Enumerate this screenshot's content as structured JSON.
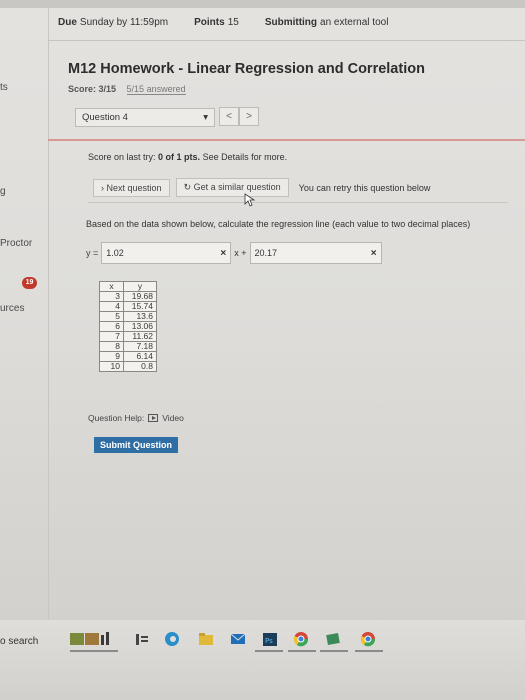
{
  "sidebar": {
    "partial_1": "ts",
    "partial_2": "g",
    "partial_3": "Proctor",
    "badge": "19",
    "partial_4": "urces"
  },
  "header": {
    "due_label": "Due",
    "due_value": "Sunday by 11:59pm",
    "points_label": "Points",
    "points_value": "15",
    "submitting_label": "Submitting",
    "submitting_value": "an external tool"
  },
  "assignment": {
    "title": "M12 Homework - Linear Regression and Correlation",
    "score": "Score: 3/15",
    "answered": "5/15 answered"
  },
  "question_nav": {
    "selected": "Question 4",
    "prev": "<",
    "next": ">"
  },
  "feedback": {
    "score_prefix": "Score on last try:",
    "score_value": "0 of 1 pts.",
    "score_suffix": "See Details for more."
  },
  "buttons": {
    "next_question": "Next question",
    "similar_question": "Get a similar question",
    "retry_note": "You can retry this question below"
  },
  "question": {
    "instruction": "Based on the data shown below, calculate the regression line (each value to two decimal places)",
    "eq_prefix": "y =",
    "slope_value": "1.02",
    "op": "x +",
    "intercept_value": "20.17",
    "x_mark": "×",
    "table_headers": [
      "x",
      "y"
    ],
    "rows": [
      [
        "3",
        "19.68"
      ],
      [
        "4",
        "15.74"
      ],
      [
        "5",
        "13.6"
      ],
      [
        "6",
        "13.06"
      ],
      [
        "7",
        "11.62"
      ],
      [
        "8",
        "7.18"
      ],
      [
        "9",
        "6.14"
      ],
      [
        "10",
        "0.8"
      ]
    ]
  },
  "help": {
    "label": "Question Help:",
    "video": "Video"
  },
  "submit": "Submit Question",
  "taskbar": {
    "search": "o search"
  },
  "colors": {
    "submit_bg": "#2f6ea5",
    "badge_bg": "#c0392b",
    "divider_red": "#d69a92"
  }
}
